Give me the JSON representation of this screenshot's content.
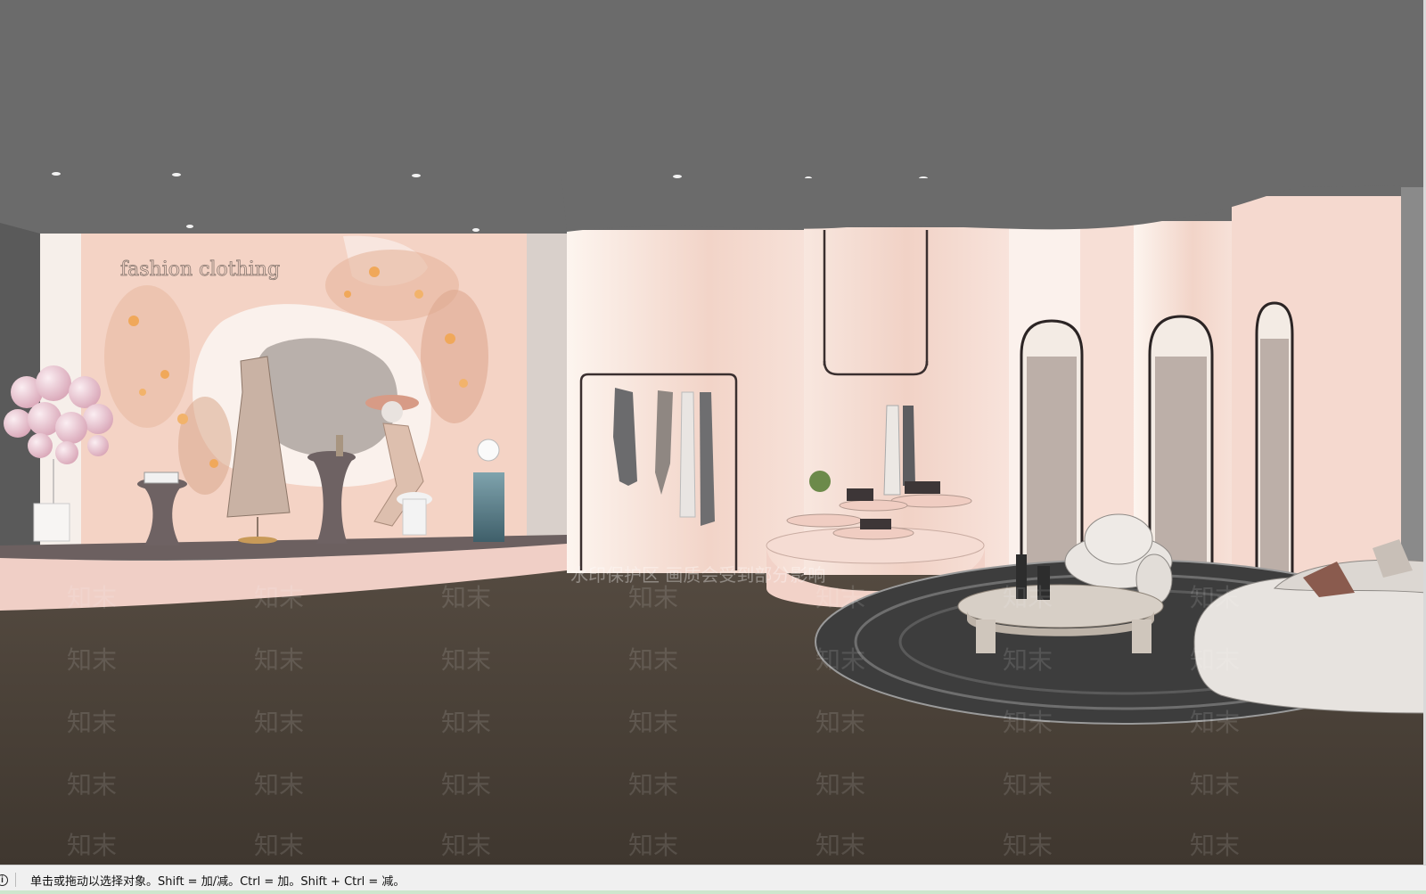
{
  "scene": {
    "wall_lettering": "fashion clothing",
    "watermark_text": "知末",
    "watermark_notice": "水印保护区 画质会受到部分影响",
    "colors": {
      "ceiling": "#6b6b6b",
      "floor": "#4a4238",
      "pink_wall": "#f3d3c8",
      "cream_wall": "#f7efe8",
      "stage": "#f0cfc6"
    }
  },
  "status_bar": {
    "icon": "info-icon",
    "message": "单击或拖动以选择对象。Shift = 加/减。Ctrl = 加。Shift + Ctrl = 减。"
  }
}
